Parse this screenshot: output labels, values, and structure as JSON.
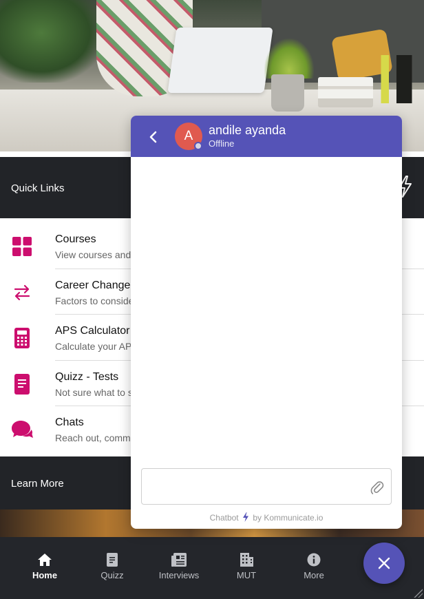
{
  "quick_links": {
    "title": "Quick Links"
  },
  "list": {
    "items": [
      {
        "title": "Courses",
        "subtitle": "View courses and",
        "icon": "grid-icon"
      },
      {
        "title": "Career Change",
        "subtitle": "Factors to conside",
        "icon": "swap-arrows-icon"
      },
      {
        "title": "APS Calculator",
        "subtitle": "Calculate your AP",
        "icon": "calculator-icon"
      },
      {
        "title": "Quizz - Tests",
        "subtitle": "Not sure what to s",
        "icon": "document-icon"
      },
      {
        "title": "Chats",
        "subtitle": "Reach out, comm",
        "icon": "chat-bubbles-icon"
      }
    ]
  },
  "learn_more": {
    "title": "Learn More"
  },
  "bottom_nav": {
    "items": [
      {
        "label": "Home",
        "icon": "home-icon",
        "active": true
      },
      {
        "label": "Quizz",
        "icon": "document-icon"
      },
      {
        "label": "Interviews",
        "icon": "newspaper-icon"
      },
      {
        "label": "MUT",
        "icon": "building-icon"
      },
      {
        "label": "More",
        "icon": "info-icon"
      }
    ]
  },
  "chat": {
    "contact_name": "andile ayanda",
    "avatar_initial": "A",
    "status": "Offline",
    "input_placeholder": "",
    "footer_prefix": "Chatbot",
    "footer_suffix": "by Kommunicate.io"
  },
  "colors": {
    "accent": "#5553b7",
    "icon_pink": "#cc0e6e",
    "avatar": "#e05a4f",
    "dark_bar": "#222428",
    "nav_bg": "#24262b"
  }
}
